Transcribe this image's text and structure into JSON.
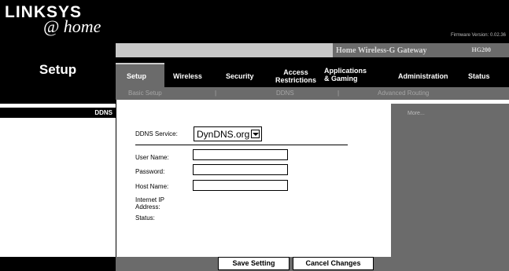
{
  "brand": {
    "logo_main": "LINKSYS",
    "logo_sub": "@ home"
  },
  "firmware": "Firmware Version: 0.02.36",
  "product": {
    "name": "Home Wireless-G Gateway",
    "model": "HG200"
  },
  "page_title": "Setup",
  "tabs": [
    {
      "label": "Setup"
    },
    {
      "label": "Wireless"
    },
    {
      "label": "Security"
    },
    {
      "label": "Access\nRestrictions"
    },
    {
      "label": "Applications\n& Gaming"
    },
    {
      "label": "Administration"
    },
    {
      "label": "Status"
    }
  ],
  "subnav": {
    "items": [
      "Basic Setup",
      "DDNS",
      "Advanced Routing"
    ],
    "separator": "|"
  },
  "section": {
    "label": "DDNS"
  },
  "form": {
    "service_label": "DDNS Service:",
    "service_value": "DynDNS.org",
    "username_label": "User Name:",
    "password_label": "Password:",
    "hostname_label": "Host Name:",
    "internet_ip_label": "Internet IP Address:",
    "status_label": "Status:"
  },
  "help": {
    "more": "More..."
  },
  "buttons": {
    "save": "Save Setting",
    "cancel": "Cancel Changes"
  }
}
